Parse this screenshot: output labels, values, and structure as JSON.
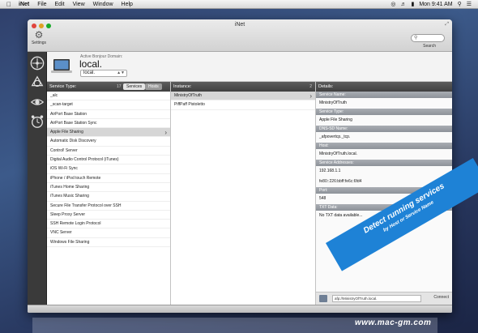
{
  "menubar": {
    "apple": "",
    "app_name": "iNet",
    "items": [
      "File",
      "Edit",
      "View",
      "Window",
      "Help"
    ],
    "clock": "Mon 9:41 AM"
  },
  "window": {
    "title": "iNet",
    "settings_label": "Settings",
    "search_label": "Search"
  },
  "domain": {
    "caption": "Active Bonjour Domain:",
    "name": "local.",
    "selected": "local."
  },
  "services": {
    "header": "Service Type:",
    "count": "17",
    "seg_services": "Services",
    "seg_hosts": "Hosts",
    "items": [
      "_alc",
      "_scan-target",
      "AirPort Base Station",
      "AirPort Base Station Sync",
      "Apple File Sharing",
      "Automatic Disk Discovery",
      "Control! Server",
      "Digital Audio Control Protocol (iTunes)",
      "iOS Wi-Fi Sync",
      "iPhone / iPod touch Remote",
      "iTunes Home Sharing",
      "iTunes Music Sharing",
      "Secure File Transfer Protocol over SSH",
      "Sleep Proxy Server",
      "SSH Remote Login Protocol",
      "VNC Server",
      "Windows File Sharing"
    ],
    "selected_index": 4
  },
  "instances": {
    "header": "Instance:",
    "count": "2",
    "items": [
      "MinistryOfTruth",
      "PiffPaff Pistoletto"
    ]
  },
  "details": {
    "header": "Details:",
    "service_name_label": "Service Name:",
    "service_name": "MinistryOfTruth",
    "service_type_label": "Service Type:",
    "service_type": "Apple File Sharing",
    "dns_sd_label": "DNS-SD Name:",
    "dns_sd": "_afpovertcp._tcp.",
    "host_label": "Host:",
    "host": "MinistryOfTruth.local.",
    "addresses_label": "Service Addresses:",
    "address_v4": "192.168.1.1",
    "address_v6": "fe80::226:bbff:fe6c:6fd4",
    "port_label": "Port:",
    "port": "548",
    "txt_label": "TXT Data:",
    "txt": "No TXT data available...",
    "footer_field": "afp://MinistryOfTruth.local.",
    "footer_button": "Connect"
  },
  "banner": {
    "main": "Detect running services",
    "sub": "by Host or Service Name"
  },
  "watermark": "www.mac-gm.com"
}
